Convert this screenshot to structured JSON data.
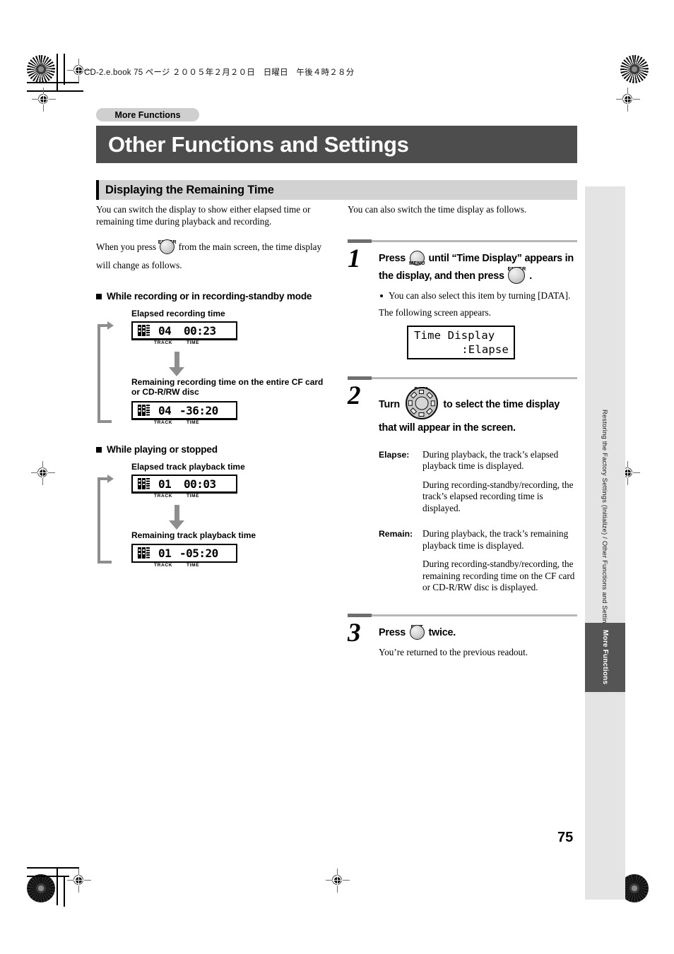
{
  "header": {
    "running_header": "CD-2.e.book  75 ページ  ２００５年２月２０日　日曜日　午後４時２８分"
  },
  "chapter_pill": "More Functions",
  "title": "Other Functions and Settings",
  "section_title": "Displaying the Remaining Time",
  "left_column": {
    "intro_1": "You can switch the display to show either elapsed time or remaining time during playback and recording.",
    "intro_2_before": "When you press",
    "intro_2_after": "from the main screen, the time display will change as follows.",
    "enter_button_label": "ENTER",
    "subhead_1": "While recording or in recording-standby mode",
    "diagram_1": {
      "caption_top": "Elapsed recording time",
      "caption_bottom": "Remaining recording time on the entire CF card or CD-R/RW disc",
      "display_top": {
        "card_icon": "cf-card-icon",
        "track": "04",
        "time": "00:23",
        "label_track": "TRACK",
        "label_time": "TIME"
      },
      "display_bottom": {
        "card_icon": "cf-card-icon",
        "track": "04",
        "time": "-36:20",
        "label_track": "TRACK",
        "label_time": "TIME"
      }
    },
    "subhead_2": "While playing or stopped",
    "diagram_2": {
      "caption_top": "Elapsed track playback time",
      "caption_bottom": "Remaining track playback time",
      "display_top": {
        "card_icon": "cf-card-icon",
        "track": "01",
        "time": "00:03",
        "label_track": "TRACK",
        "label_time": "TIME"
      },
      "display_bottom": {
        "card_icon": "cf-card-icon",
        "track": "01",
        "time": "-05:20",
        "label_track": "TRACK",
        "label_time": "TIME"
      }
    }
  },
  "right_column": {
    "intro": "You can also switch the time display as follows.",
    "steps": [
      {
        "number": "1",
        "headline_part_1": "Press",
        "headline_part_2": "until “Time Display” appears in the display, and then press",
        "headline_part_3": ".",
        "button_1_label": "MENU",
        "button_2_label": "ENTER",
        "bullet": "You can also select this item by turning [DATA].",
        "note": "The following screen appears.",
        "lcd": {
          "line1": "Time Display",
          "line2": ":Elapse"
        }
      },
      {
        "number": "2",
        "headline_part_1": "Turn",
        "headline_part_2": "to select the time display that will appear in the screen.",
        "knob_label": "DATA",
        "definitions": [
          {
            "term": "Elapse:",
            "paragraphs": [
              "During playback, the track’s elapsed playback time is displayed.",
              "During recording-standby/recording, the track’s elapsed recording time is displayed."
            ]
          },
          {
            "term": "Remain:",
            "paragraphs": [
              "During playback, the track’s remaining playback time is displayed.",
              "During recording-standby/recording, the remaining recording time on the CF card or CD-R/RW disc is displayed."
            ]
          }
        ]
      },
      {
        "number": "3",
        "headline_part_1": "Press",
        "headline_part_2": "twice.",
        "button_label": "EXIT",
        "note": "You’re returned to the previous readout."
      }
    ]
  },
  "edge": {
    "side_text": "Restoring the Factory Settings (Initialize) / Other Functions and Settings",
    "tab_text": "More Functions"
  },
  "page_number": "75",
  "colors": {
    "title_bar": "#4d4d4d",
    "section_bar": "#d2d2d2",
    "pill": "#cfcfcf",
    "edge_band": "#e4e4e4",
    "edge_tab": "#555555",
    "arrow_gray": "#8e8e8e"
  }
}
